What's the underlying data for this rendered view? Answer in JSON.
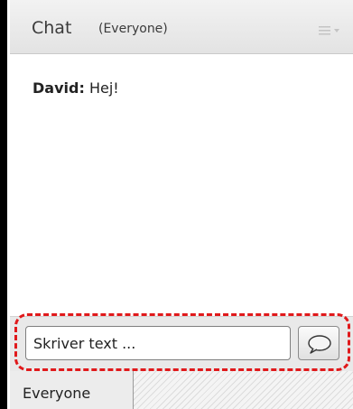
{
  "header": {
    "title": "Chat",
    "subtitle": "(Everyone)",
    "menu_icon": "menu-lines-icon"
  },
  "messages": [
    {
      "sender": "David:",
      "text": "Hej!"
    }
  ],
  "composer": {
    "value": "Skriver text ...",
    "send_icon": "speech-bubble-icon",
    "highlight_color": "#e0191b"
  },
  "tabs": [
    {
      "label": "Everyone"
    }
  ]
}
